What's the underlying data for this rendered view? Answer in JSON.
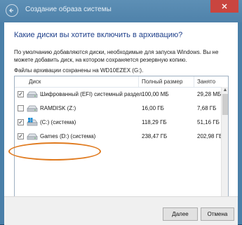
{
  "window": {
    "title": "Создание образа системы"
  },
  "dialog": {
    "heading": "Какие диски вы хотите включить в архивацию?",
    "description": "По умолчанию добавляются диски, необходимые для запуска Windows. Вы не можете добавить диск, на котором сохраняется резервную копию.",
    "location": "Файлы архивации сохранены на WD10EZEX (G:)."
  },
  "table": {
    "columns": {
      "disk": "Диск",
      "total": "Полный размер",
      "used": "Занято"
    },
    "rows": [
      {
        "name": "Шифрованный (EFI) системный раздел",
        "total": "100,00 МБ",
        "used": "29,28 МБ",
        "checked": true,
        "icon": "drive-icon"
      },
      {
        "name": "RAMDISK (Z:)",
        "total": "16,00 ГБ",
        "used": "7,68 ГБ",
        "checked": false,
        "icon": "drive-icon"
      },
      {
        "name": "(C:) (система)",
        "total": "118,29 ГБ",
        "used": "51,16 ГБ",
        "checked": true,
        "icon": "windows-drive-icon"
      },
      {
        "name": "Games (D:) (система)",
        "total": "238,47 ГБ",
        "used": "202,98 ГБ",
        "checked": true,
        "icon": "drive-icon"
      }
    ]
  },
  "buttons": {
    "next": "Далее",
    "cancel": "Отмена"
  },
  "colors": {
    "title_bar": "#4f82aa",
    "heading": "#1e3f8a",
    "highlight_circle": "#e07a1e",
    "close_button": "#c9453f"
  }
}
